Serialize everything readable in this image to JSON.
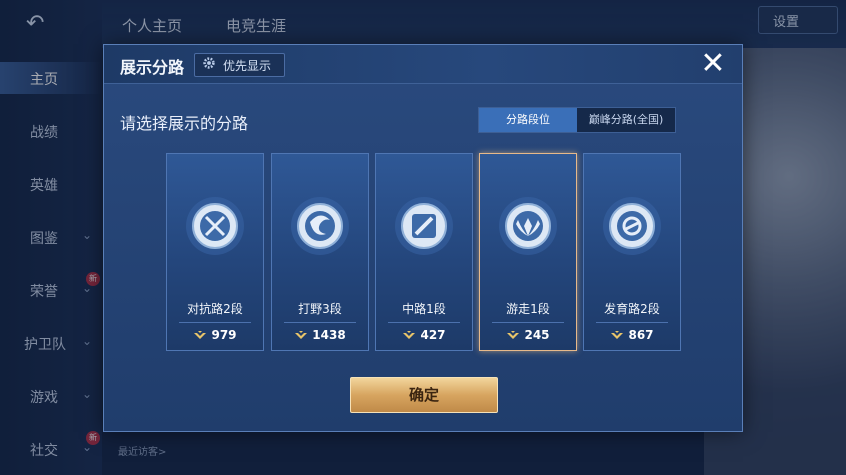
{
  "nav": {
    "back_icon": "back-arrow-icon",
    "items": [
      {
        "label": "主页",
        "active": true,
        "chevron": false,
        "badge": ""
      },
      {
        "label": "战绩",
        "active": false,
        "chevron": false,
        "badge": ""
      },
      {
        "label": "英雄",
        "active": false,
        "chevron": false,
        "badge": ""
      },
      {
        "label": "图鉴",
        "active": false,
        "chevron": true,
        "badge": ""
      },
      {
        "label": "荣誉",
        "active": false,
        "chevron": true,
        "badge": "新"
      },
      {
        "label": "护卫队",
        "active": false,
        "chevron": true,
        "badge": ""
      },
      {
        "label": "游戏",
        "active": false,
        "chevron": true,
        "badge": ""
      },
      {
        "label": "社交",
        "active": false,
        "chevron": true,
        "badge": "新"
      }
    ]
  },
  "top_tabs": [
    "个人主页",
    "电竞生涯"
  ],
  "top_right": {
    "label": "设置"
  },
  "bottom": {
    "visitor_label": "最近访客>"
  },
  "modal": {
    "title": "展示分路",
    "priority_label": "优先显示",
    "close_icon": "close-icon",
    "subtitle": "请选择展示的分路",
    "segments": [
      {
        "label": "分路段位",
        "active": true
      },
      {
        "label": "巅峰分路(全国)",
        "active": false
      }
    ],
    "cards": [
      {
        "name": "对抗路2段",
        "score": "979",
        "icon": "sword-emblem-icon",
        "selected": false
      },
      {
        "name": "打野3段",
        "score": "1438",
        "icon": "swirl-emblem-icon",
        "selected": false
      },
      {
        "name": "中路1段",
        "score": "427",
        "icon": "slash-emblem-icon",
        "selected": false
      },
      {
        "name": "游走1段",
        "score": "245",
        "icon": "wings-emblem-icon",
        "selected": true
      },
      {
        "name": "发育路2段",
        "score": "867",
        "icon": "target-emblem-icon",
        "selected": false
      }
    ],
    "confirm_label": "确定"
  },
  "colors": {
    "accent_blue": "#3a6fb8",
    "selected_border": "#e7b98a",
    "confirm_gold": "#d7a560"
  }
}
